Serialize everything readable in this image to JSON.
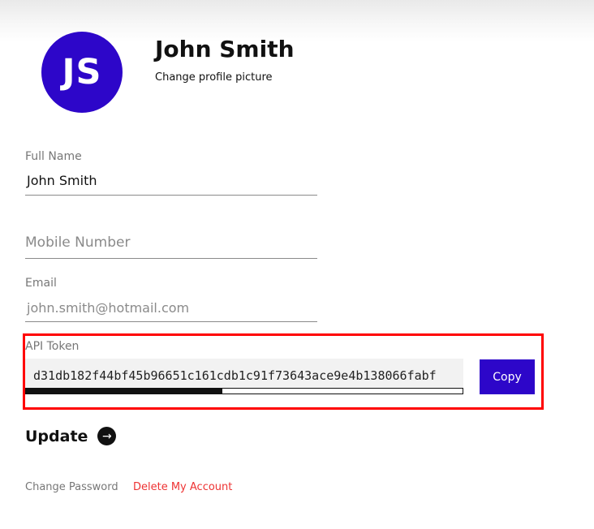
{
  "profile": {
    "initials": "JS",
    "name": "John Smith",
    "change_picture": "Change profile picture",
    "avatar_color": "#2d06c9"
  },
  "fields": {
    "full_name": {
      "label": "Full Name",
      "value": "John Smith"
    },
    "mobile": {
      "placeholder": "Mobile Number",
      "value": ""
    },
    "email": {
      "label": "Email",
      "value": "john.smith@hotmail.com"
    },
    "api_token": {
      "label": "API Token",
      "value": "d31db182f44bf45b96651c161cdb1c91f73643ace9e4b138066fabf"
    }
  },
  "actions": {
    "copy": "Copy",
    "update": "Update",
    "change_password": "Change Password",
    "delete_account": "Delete My Account"
  },
  "icons": {
    "update_arrow": "arrow-right-icon"
  },
  "colors": {
    "accent": "#2d06c9",
    "danger": "#ee3333",
    "highlight": "#ff0000"
  }
}
